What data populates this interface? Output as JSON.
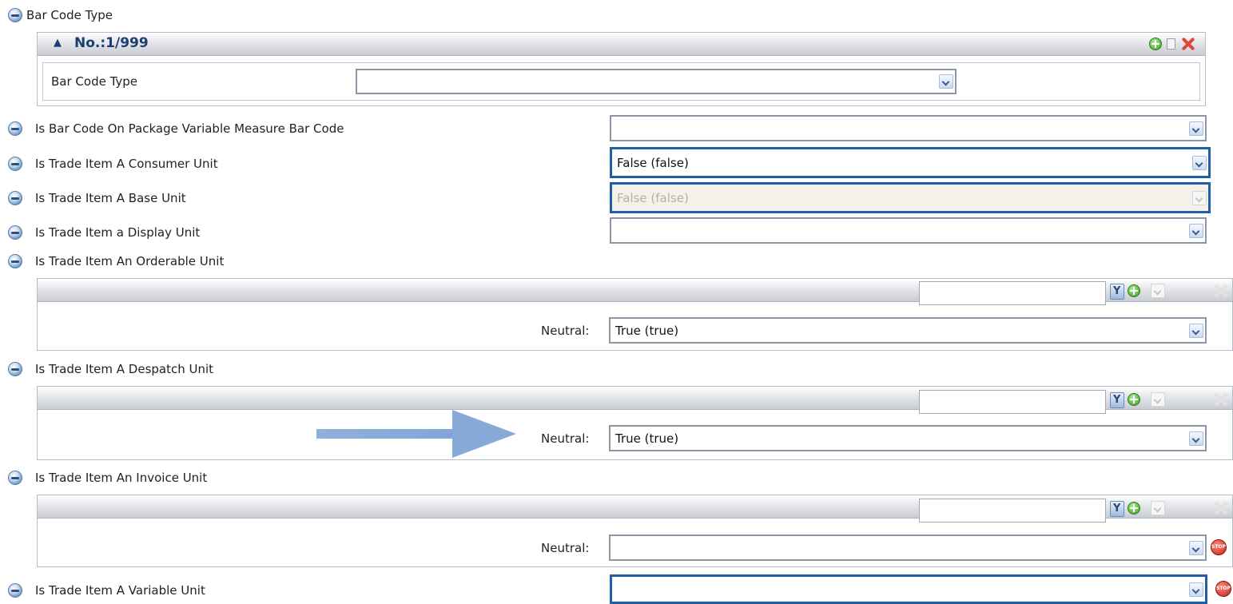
{
  "sections": {
    "bar_code_type": {
      "label": "Bar Code Type",
      "panel": {
        "number": "No.:1/999",
        "field_label": "Bar Code Type",
        "field_value": ""
      }
    },
    "variable_measure": {
      "label": "Is Bar Code On Package Variable Measure Bar Code",
      "value": ""
    },
    "consumer_unit": {
      "label": "Is Trade Item A Consumer Unit",
      "value": "False (false)"
    },
    "base_unit": {
      "label": "Is Trade Item A Base Unit",
      "value": "False (false)"
    },
    "display_unit": {
      "label": "Is Trade Item a Display Unit",
      "value": ""
    },
    "orderable_unit": {
      "label": "Is Trade Item An Orderable Unit",
      "neutral_label": "Neutral:",
      "neutral_value": "True (true)"
    },
    "despatch_unit": {
      "label": "Is Trade Item A Despatch Unit",
      "neutral_label": "Neutral:",
      "neutral_value": "True (true)"
    },
    "invoice_unit": {
      "label": "Is Trade Item An Invoice Unit",
      "neutral_label": "Neutral:",
      "neutral_value": ""
    },
    "variable_unit": {
      "label": "Is Trade Item A Variable Unit",
      "value": ""
    }
  },
  "icons": {
    "help": "help-icon",
    "add": "plus-icon",
    "copy": "copy-icon",
    "delete": "x-icon",
    "filter": "filter-icon",
    "stop": "stop-icon",
    "stop_text": "STOP"
  },
  "colors": {
    "focus_border": "#1f5fa8",
    "panel_number": "#1b3f73",
    "arrow": "#86a9d8"
  }
}
